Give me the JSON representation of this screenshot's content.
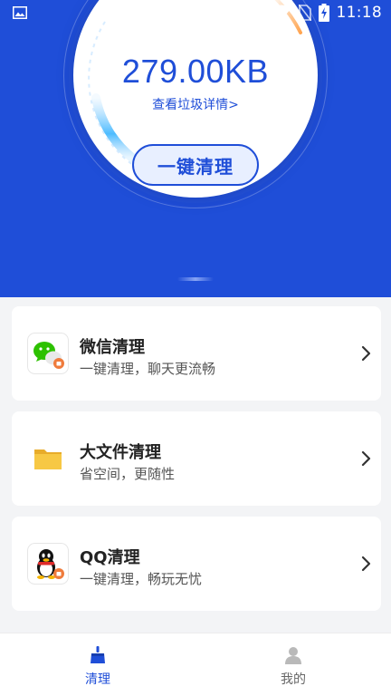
{
  "statusbar": {
    "time": "11:18",
    "icons": [
      "image-icon",
      "wifi-icon",
      "no-sim-icon",
      "battery-charging-icon"
    ]
  },
  "hero": {
    "junk_size": "279.00KB",
    "detail_link": "查看垃圾详情>",
    "clean_button": "一键清理"
  },
  "cards": [
    {
      "title": "微信清理",
      "subtitle": "一键清理，聊天更流畅",
      "icon": "wechat-icon"
    },
    {
      "title": "大文件清理",
      "subtitle": "省空间，更随性",
      "icon": "folder-icon"
    },
    {
      "title": "QQ清理",
      "subtitle": "一键清理，畅玩无忧",
      "icon": "qq-icon"
    }
  ],
  "bottom_nav": {
    "tabs": [
      {
        "label": "清理",
        "icon": "broom-icon",
        "active": true
      },
      {
        "label": "我的",
        "icon": "user-icon",
        "active": false
      }
    ]
  },
  "colors": {
    "primary": "#1f4ed8",
    "background": "#f3f4f6",
    "card": "#ffffff",
    "wechat_green": "#2dc100",
    "folder_yellow": "#f7c844",
    "badge_orange": "#ef7b3c"
  }
}
